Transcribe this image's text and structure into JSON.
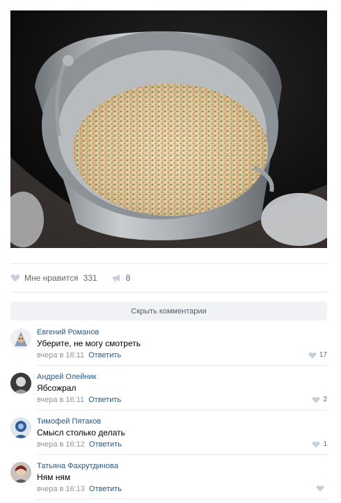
{
  "post": {
    "image_alt": "salad-bucket-photo",
    "likes_label": "Мне нравится",
    "likes_count": "331",
    "shares_count": "8"
  },
  "comments_toggle": "Скрыть комментарии",
  "comments": [
    {
      "author": "Евгений Романов",
      "text": "Уберите, не могу смотреть",
      "time": "вчера в 16:11",
      "reply": "Ответить",
      "likes": "17"
    },
    {
      "author": "Андрей Олейник",
      "text": "Ябсожрал",
      "time": "вчера в 16:11",
      "reply": "Ответить",
      "likes": "2"
    },
    {
      "author": "Тимофей Пятаков",
      "text": "Смысл столько делать",
      "time": "вчера в 16:12",
      "reply": "Ответить",
      "likes": "1"
    },
    {
      "author": "Татьяна Фахрутдинова",
      "text": "Ням ням",
      "time": "вчера в 16:13",
      "reply": "Ответить",
      "likes": ""
    }
  ],
  "icons": {
    "like": "heart-icon",
    "share": "megaphone-icon"
  },
  "colors": {
    "link": "#2a5885",
    "muted": "#939393",
    "button_bg": "#f0f2f5"
  }
}
